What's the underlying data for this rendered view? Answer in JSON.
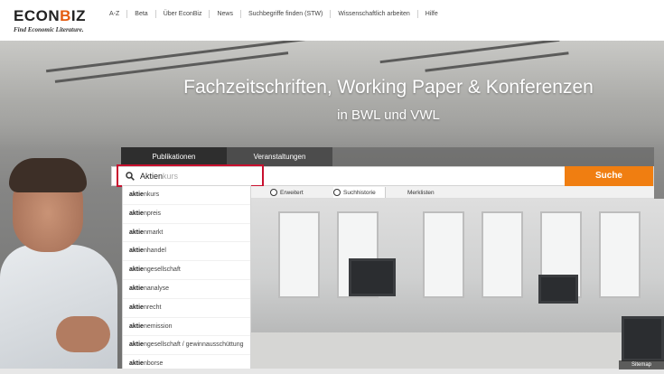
{
  "logo": {
    "main_prefix": "ECON",
    "main_accent": "B",
    "main_suffix": "IZ",
    "subtitle": "Find Economic Literature."
  },
  "nav": [
    "A-Z",
    "Beta",
    "Über EconBiz",
    "News",
    "Suchbegriffe finden (STW)",
    "Wissenschaftlich arbeiten",
    "Hilfe"
  ],
  "hero": {
    "title": "Fachzeitschriften, Working Paper & Konferenzen",
    "subtitle": "in BWL und VWL"
  },
  "tabs": {
    "active": "Publikationen",
    "inactive": "Veranstaltungen"
  },
  "search": {
    "value": "",
    "typed": "Aktien",
    "ghost_completion": "kurs",
    "button_label": "Suche"
  },
  "options": {
    "advanced": "Erweitert",
    "history": "Suchhistorie",
    "watchlist": "Merklisten"
  },
  "suggestions": [
    {
      "prefix": "aktie",
      "rest": "nkurs"
    },
    {
      "prefix": "aktie",
      "rest": "npreis"
    },
    {
      "prefix": "aktie",
      "rest": "nmarkt"
    },
    {
      "prefix": "aktie",
      "rest": "nhandel"
    },
    {
      "prefix": "aktie",
      "rest": "ngesellschaft"
    },
    {
      "prefix": "aktie",
      "rest": "nanalyse"
    },
    {
      "prefix": "aktie",
      "rest": "nrecht"
    },
    {
      "prefix": "aktie",
      "rest": "nemission"
    },
    {
      "prefix": "aktie",
      "rest": "ngesellschaft / gewinnausschüttung"
    },
    {
      "prefix": "aktie",
      "rest": "nborse"
    }
  ],
  "footer": {
    "sitemap": "Sitemap"
  },
  "colors": {
    "accent": "#f07e11",
    "highlight": "#c8102e",
    "tab_active": "#2e2e2e"
  }
}
